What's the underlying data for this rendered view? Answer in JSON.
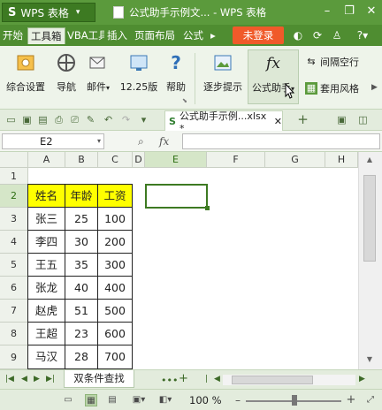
{
  "app": {
    "brand_label": "WPS 表格",
    "window_title": "公式助手示例文... - WPS 表格",
    "brand_color": "#5b9a3c"
  },
  "menu": {
    "items": [
      "开始",
      "工具箱",
      "VBA工具",
      "插入",
      "页面布局",
      "公式"
    ],
    "active": "工具箱",
    "login_label": "未登录"
  },
  "ribbon": {
    "buttons": [
      {
        "label": "综合设置",
        "icon": "settings-icon"
      },
      {
        "label": "导航",
        "icon": "compass-icon"
      },
      {
        "label": "邮件",
        "icon": "mail-icon"
      },
      {
        "label": "12.25版",
        "icon": "monitor-icon"
      },
      {
        "label": "帮助",
        "icon": "help-icon"
      },
      {
        "label": "逐步提示",
        "icon": "picture-icon"
      },
      {
        "label": "公式助手",
        "icon": "fx-icon"
      }
    ],
    "small_buttons": [
      {
        "label": "间隔空行",
        "icon": "spacing-icon"
      },
      {
        "label": "套用风格",
        "icon": "style-icon"
      }
    ]
  },
  "file_tab": {
    "label": "公式助手示例...xlsx *"
  },
  "formula_bar": {
    "name_box": "E2",
    "formula": ""
  },
  "grid": {
    "columns": [
      "A",
      "B",
      "C",
      "D",
      "E",
      "F",
      "G",
      "H"
    ],
    "rows": [
      "1",
      "2",
      "3",
      "4",
      "5",
      "6",
      "7",
      "8",
      "9"
    ],
    "selected_column": "E",
    "selected_row": "2",
    "header_fill": "#ffff00",
    "table": [
      [
        "姓名",
        "年龄",
        "工资"
      ],
      [
        "张三",
        "25",
        "100"
      ],
      [
        "李四",
        "30",
        "200"
      ],
      [
        "王五",
        "35",
        "300"
      ],
      [
        "张龙",
        "40",
        "400"
      ],
      [
        "赵虎",
        "51",
        "500"
      ],
      [
        "王超",
        "23",
        "600"
      ],
      [
        "马汉",
        "28",
        "700"
      ]
    ]
  },
  "sheet_tabs": {
    "active": "双条件查找"
  },
  "status": {
    "zoom": "100 %"
  }
}
